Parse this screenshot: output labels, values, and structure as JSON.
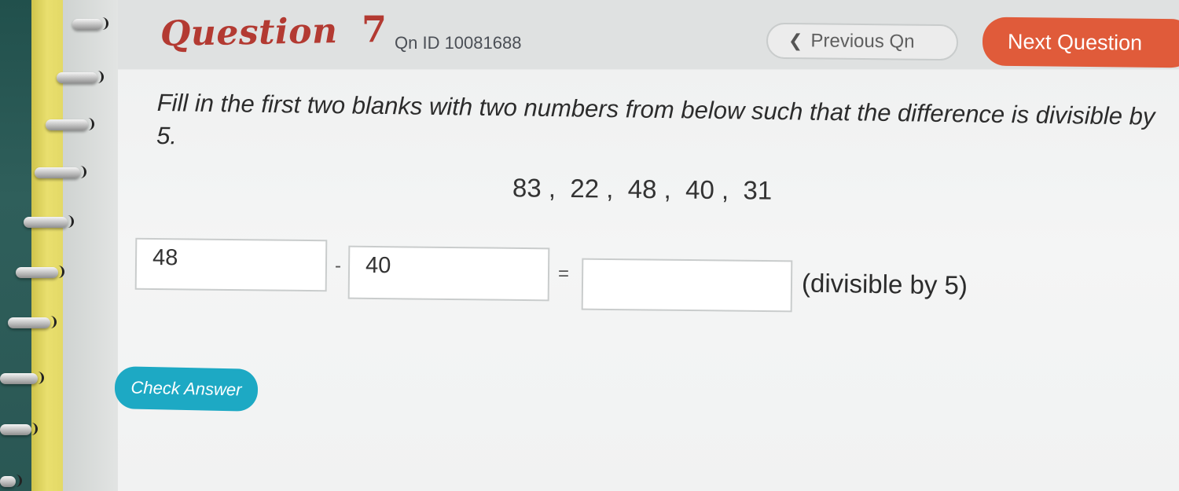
{
  "header": {
    "title": "Question",
    "question_number": "7",
    "qn_id": "Qn ID 10081688",
    "previous_button": "Previous Qn",
    "next_button": "Next Question"
  },
  "question": {
    "prompt": "Fill in the first two blanks with two numbers from below such that the difference is divisible by 5.",
    "options_text": "83 ,  22 ,  48 ,  40 ,  31"
  },
  "answer": {
    "first_blank_value": "48",
    "second_blank_value": "40",
    "result_blank_value": "",
    "minus_symbol": "-",
    "equals_symbol": "=",
    "condition_text": "(divisible by 5)"
  },
  "actions": {
    "check_answer": "Check Answer"
  },
  "colors": {
    "title": "#b33a32",
    "next_button_bg": "#e05b3a",
    "check_button_bg": "#1da9c4"
  },
  "icons": {
    "previous_icon": "chevron-left-icon"
  }
}
